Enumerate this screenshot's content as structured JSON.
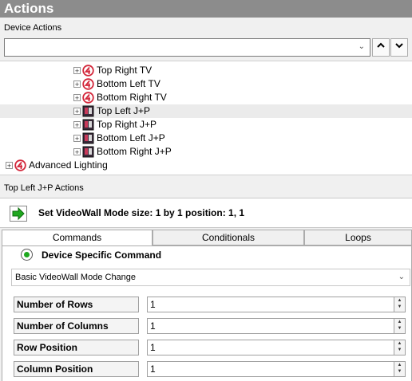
{
  "window": {
    "title": "Actions"
  },
  "device_actions": {
    "label": "Device Actions",
    "combo_value": "",
    "tree": [
      {
        "label": "Top Right TV",
        "icon": "crestron-logo-icon",
        "indent": 2
      },
      {
        "label": "Bottom Left TV",
        "icon": "crestron-logo-icon",
        "indent": 2
      },
      {
        "label": "Bottom Right TV",
        "icon": "crestron-logo-icon",
        "indent": 2
      },
      {
        "label": "Top Left J+P",
        "icon": "display-device-icon",
        "indent": 2,
        "selected": true
      },
      {
        "label": "Top Right J+P",
        "icon": "display-device-icon",
        "indent": 2
      },
      {
        "label": "Bottom Left J+P",
        "icon": "display-device-icon",
        "indent": 2
      },
      {
        "label": "Bottom Right J+P",
        "icon": "display-device-icon",
        "indent": 2
      },
      {
        "label": "Advanced Lighting",
        "icon": "crestron-logo-icon",
        "indent": 0
      }
    ]
  },
  "selected_actions": {
    "label": "Top Left J+P Actions",
    "command_text": "Set VideoWall Mode  size:  1 by 1  position:  1,  1"
  },
  "tabs": [
    "Commands",
    "Conditionals",
    "Loops"
  ],
  "commands": {
    "device_specific_label": "Device Specific Command",
    "command_select": "Basic VideoWall Mode Change",
    "params": [
      {
        "label": "Number of Rows",
        "value": "1"
      },
      {
        "label": "Number of Columns",
        "value": "1"
      },
      {
        "label": "Row Position",
        "value": "1"
      },
      {
        "label": "Column Position",
        "value": "1"
      }
    ]
  },
  "colors": {
    "title_bar": "#8c8c8c",
    "crestron_red": "#d3263a",
    "play_green": "#1fa81f"
  }
}
